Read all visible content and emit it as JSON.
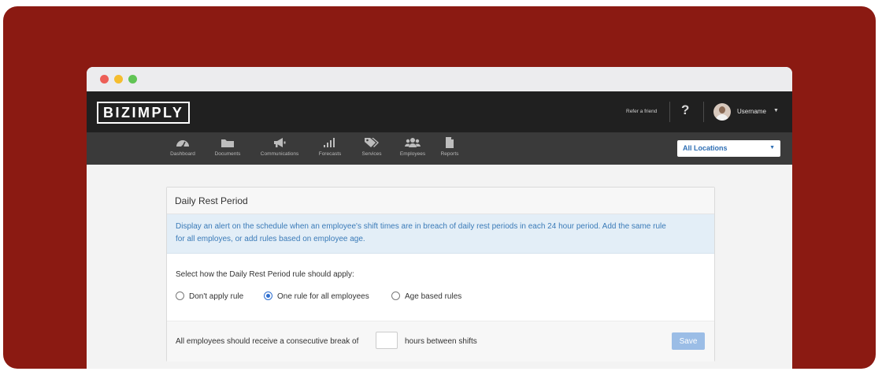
{
  "window": {
    "controls": [
      "close",
      "minimize",
      "zoom"
    ]
  },
  "topbar": {
    "logo": "BIZIMPLY",
    "refer_link": "Refer a friend",
    "help_label": "?",
    "username": "Username",
    "username_caret": "▼"
  },
  "nav": {
    "items": [
      {
        "label": "Dashboard",
        "icon": "dashboard-icon"
      },
      {
        "label": "Documents",
        "icon": "folder-icon"
      },
      {
        "label": "Communications",
        "icon": "megaphone-icon"
      },
      {
        "label": "Forecasts",
        "icon": "signal-bars-icon"
      },
      {
        "label": "Services",
        "icon": "tags-icon"
      },
      {
        "label": "Employees",
        "icon": "users-icon"
      },
      {
        "label": "Reports",
        "icon": "document-icon"
      }
    ],
    "location_select": {
      "value": "All Locations",
      "caret": "▼"
    }
  },
  "card": {
    "title": "Daily Rest Period",
    "info_line1": "Display an alert on the schedule when an employee's shift times are in breach of daily rest periods in each 24 hour period. Add the same rule",
    "info_line2": "for all employes, or add rules based on employee age.",
    "question": "Select how the Daily Rest Period rule should apply:",
    "options": [
      {
        "label": "Don't apply rule",
        "selected": false
      },
      {
        "label": "One rule for all employees",
        "selected": true
      },
      {
        "label": "Age based rules",
        "selected": false
      }
    ],
    "break_prefix": "All employees should receive a consecutive break of",
    "break_hours_value": "",
    "break_suffix": "hours between shifts",
    "save_label": "Save"
  },
  "colors": {
    "frame": "#8b1a12",
    "topbar": "#202020",
    "navbar": "#3a3a3a",
    "info_bg": "#e3eef7",
    "info_text": "#3b7bb8",
    "accent": "#2f6fd0",
    "save_button": "#9bbde6"
  }
}
